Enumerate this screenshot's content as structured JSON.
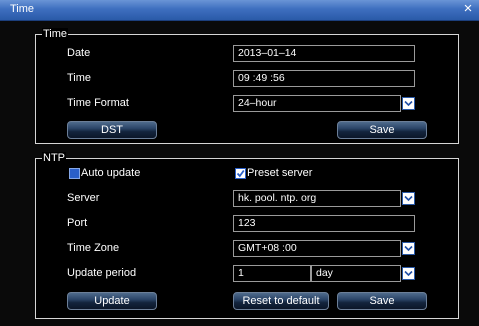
{
  "window": {
    "title": "Time",
    "close_icon": "close-icon"
  },
  "time_section": {
    "legend": "Time",
    "date_label": "Date",
    "date_value": "2013–01–14",
    "time_label": "Time",
    "time_value": "09 :49 :56",
    "format_label": "Time Format",
    "format_value": "24–hour",
    "dst_button": "DST",
    "save_button": "Save"
  },
  "ntp_section": {
    "legend": "NTP",
    "auto_update_label": "Auto update",
    "auto_update_checked": false,
    "preset_server_label": "Preset server",
    "preset_server_checked": true,
    "server_label": "Server",
    "server_value": "hk. pool. ntp. org",
    "port_label": "Port",
    "port_value": "123",
    "timezone_label": "Time Zone",
    "timezone_value": "GMT+08 :00",
    "period_label": "Update period",
    "period_value": "1",
    "period_unit": "day",
    "update_button": "Update",
    "reset_button": "Reset  to  default",
    "save_button": "Save"
  },
  "colors": {
    "titlebar": "#3e6fbf",
    "background": "#000000",
    "border": "#d6d6d6",
    "accent": "#2a5fc9"
  }
}
